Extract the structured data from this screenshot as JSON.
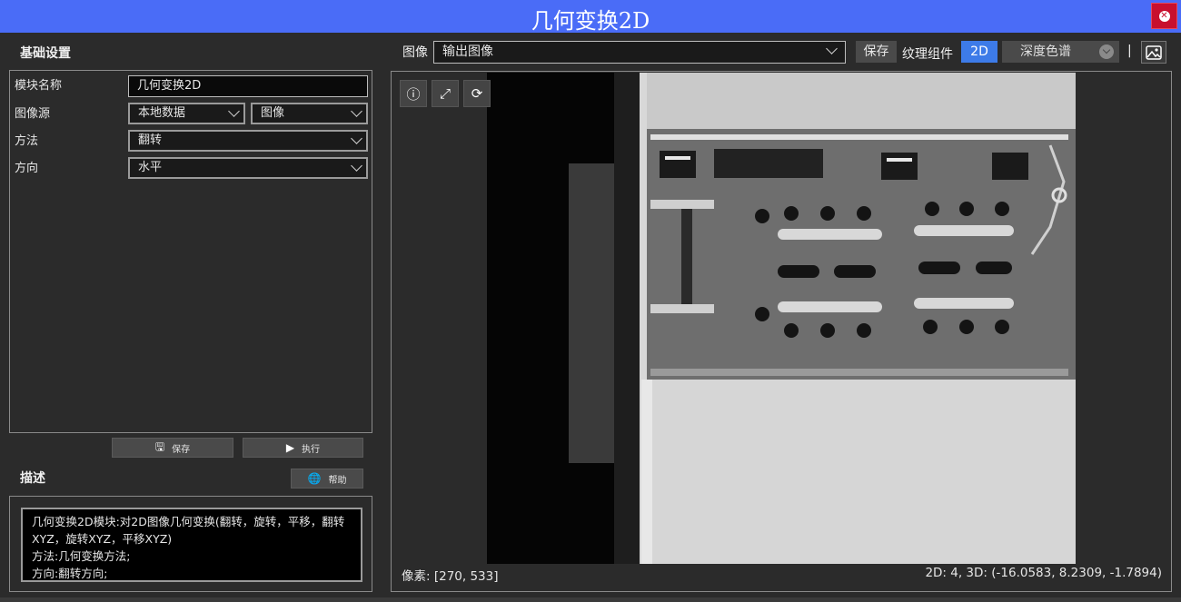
{
  "window": {
    "title": "几何变换2D"
  },
  "basic": {
    "title": "基础设置",
    "rows": [
      {
        "label": "模块名称",
        "value": "几何变换2D"
      },
      {
        "label": "图像源",
        "value": "本地数据",
        "value2": "图像"
      },
      {
        "label": "方法",
        "value": "翻转"
      },
      {
        "label": "方向",
        "value": "水平"
      }
    ],
    "save_label": "保存",
    "run_label": "执行"
  },
  "description": {
    "title": "描述",
    "help_label": "帮助",
    "lines": [
      "几何变换2D模块:对2D图像几何变换(翻转，旋转，平移，翻转",
      "XYZ，旋转XYZ，平移XYZ)",
      "方法:几何变换方法;",
      "方向:翻转方向;"
    ]
  },
  "toolbar": {
    "image_label": "图像",
    "image_select": "输出图像",
    "save_label": "保存",
    "texture_label": "纹理组件",
    "mode_2d": "2D",
    "depth_colormap": "深度色谱",
    "separator": "|"
  },
  "viewer": {
    "pixel_status": "像素: [270, 533]",
    "coord_status": "2D: 4, 3D: (-16.0583, 8.2309, -1.7894)"
  },
  "colors": {
    "titlebar": "#4a6cf7",
    "close": "#c8102e",
    "active": "#3d7be8"
  }
}
